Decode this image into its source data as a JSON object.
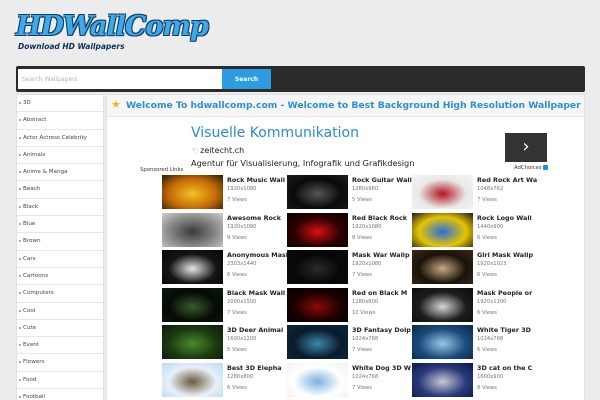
{
  "header": {
    "logo_main": "HDWallComp",
    "logo_sub": "Download HD Wallpapers"
  },
  "search": {
    "placeholder": "Search Wallpapers",
    "button_label": "Search"
  },
  "sidebar": {
    "items": [
      "3D",
      "Abstract",
      "Actor Actress Celebrity",
      "Animals",
      "Anime & Manga",
      "Beach",
      "Black",
      "Blue",
      "Brown",
      "Cars",
      "Cartoons",
      "Computers",
      "Cool",
      "Cute",
      "Event",
      "Flowers",
      "Food",
      "Football"
    ]
  },
  "main": {
    "welcome_title": "Welcome To hdwallcomp.com - Welcome to Best Background High Resolution Wallpaper"
  },
  "ad": {
    "title": "Visuelle Kommunikation",
    "host": "zeitecht.ch",
    "description": "Agentur für Visualisierung, Infografik und Grafikdesign",
    "adchoices": "AdChoices",
    "sponsored": "Sponsored Links"
  },
  "wallpapers": [
    {
      "title": "Rock Music Wall",
      "res": "1920x1080",
      "views": "7 Views",
      "colors": [
        "#2a1a05",
        "#f5c020",
        "#c46a08"
      ]
    },
    {
      "title": "Rock Guitar Wall",
      "res": "1280x960",
      "views": "5 Views",
      "colors": [
        "#1c1c1c",
        "#555555",
        "#0a0a0a"
      ]
    },
    {
      "title": "Red Rock Art Wall",
      "res": "1048x762",
      "views": "7 Views",
      "colors": [
        "#f4f4f4",
        "#b3141e",
        "#e9e9e9"
      ]
    },
    {
      "title": "Awesome Rock",
      "res": "1920x1080",
      "views": "9 Views",
      "colors": [
        "#cfcfcf",
        "#3a3a3a",
        "#8a8a8a"
      ]
    },
    {
      "title": "Red Black Rock",
      "res": "1920x1080",
      "views": "8 Views",
      "colors": [
        "#120000",
        "#d81010",
        "#2a0000"
      ]
    },
    {
      "title": "Rock Logo Wall",
      "res": "1440x900",
      "views": "6 Views",
      "colors": [
        "#1a1a1a",
        "#2b6de0",
        "#e6c400"
      ]
    },
    {
      "title": "Anonymous Mask",
      "res": "2303x1440",
      "views": "6 Views",
      "colors": [
        "#050505",
        "#e8e8e8",
        "#151515"
      ]
    },
    {
      "title": "Mask War Wallp",
      "res": "1920x1080",
      "views": "7 Views",
      "colors": [
        "#0a0a0a",
        "#2a2a2a",
        "#070707"
      ]
    },
    {
      "title": "Girl Mask Wallp",
      "res": "1920x1023",
      "views": "6 Views",
      "colors": [
        "#3a2a18",
        "#c9a880",
        "#1a120a"
      ]
    },
    {
      "title": "Black Mask Wall",
      "res": "2000x1500",
      "views": "7 Views",
      "colors": [
        "#0a1a0c",
        "#3a5a2c",
        "#050a05"
      ]
    },
    {
      "title": "Red on Black M",
      "res": "1280x800",
      "views": "10 Views",
      "colors": [
        "#050000",
        "#8a0a0a",
        "#1a0000"
      ]
    },
    {
      "title": "Mask People or",
      "res": "1920x1200",
      "views": "6 Views",
      "colors": [
        "#0c0c0c",
        "#d8d8d8",
        "#1c1c1c"
      ]
    },
    {
      "title": "3D Deer Animal",
      "res": "1600x1200",
      "views": "5 Views",
      "colors": [
        "#0a1a0a",
        "#4a8a2c",
        "#1a3a10"
      ]
    },
    {
      "title": "3D Fantasy Dolp",
      "res": "1024x768",
      "views": "7 Views",
      "colors": [
        "#0a2a3a",
        "#3a8aaa",
        "#0a1a2a"
      ]
    },
    {
      "title": "White Tiger 3D",
      "res": "1024x768",
      "views": "6 Views",
      "colors": [
        "#0a2a4a",
        "#9ac8e8",
        "#1a4a7a"
      ]
    },
    {
      "title": "Best 3D Elepha",
      "res": "1280x800",
      "views": "6 Views",
      "colors": [
        "#b8d8f0",
        "#6a5a3a",
        "#e8f0f8"
      ]
    },
    {
      "title": "White Dog 3D W",
      "res": "1024x768",
      "views": "7 Views",
      "colors": [
        "#f0f0f0",
        "#7ab0e0",
        "#ffffff"
      ]
    },
    {
      "title": "3D cat on the C",
      "res": "1600x900",
      "views": "8 Views",
      "colors": [
        "#0a1a4a",
        "#c8c8d8",
        "#2a3a7a"
      ]
    }
  ]
}
